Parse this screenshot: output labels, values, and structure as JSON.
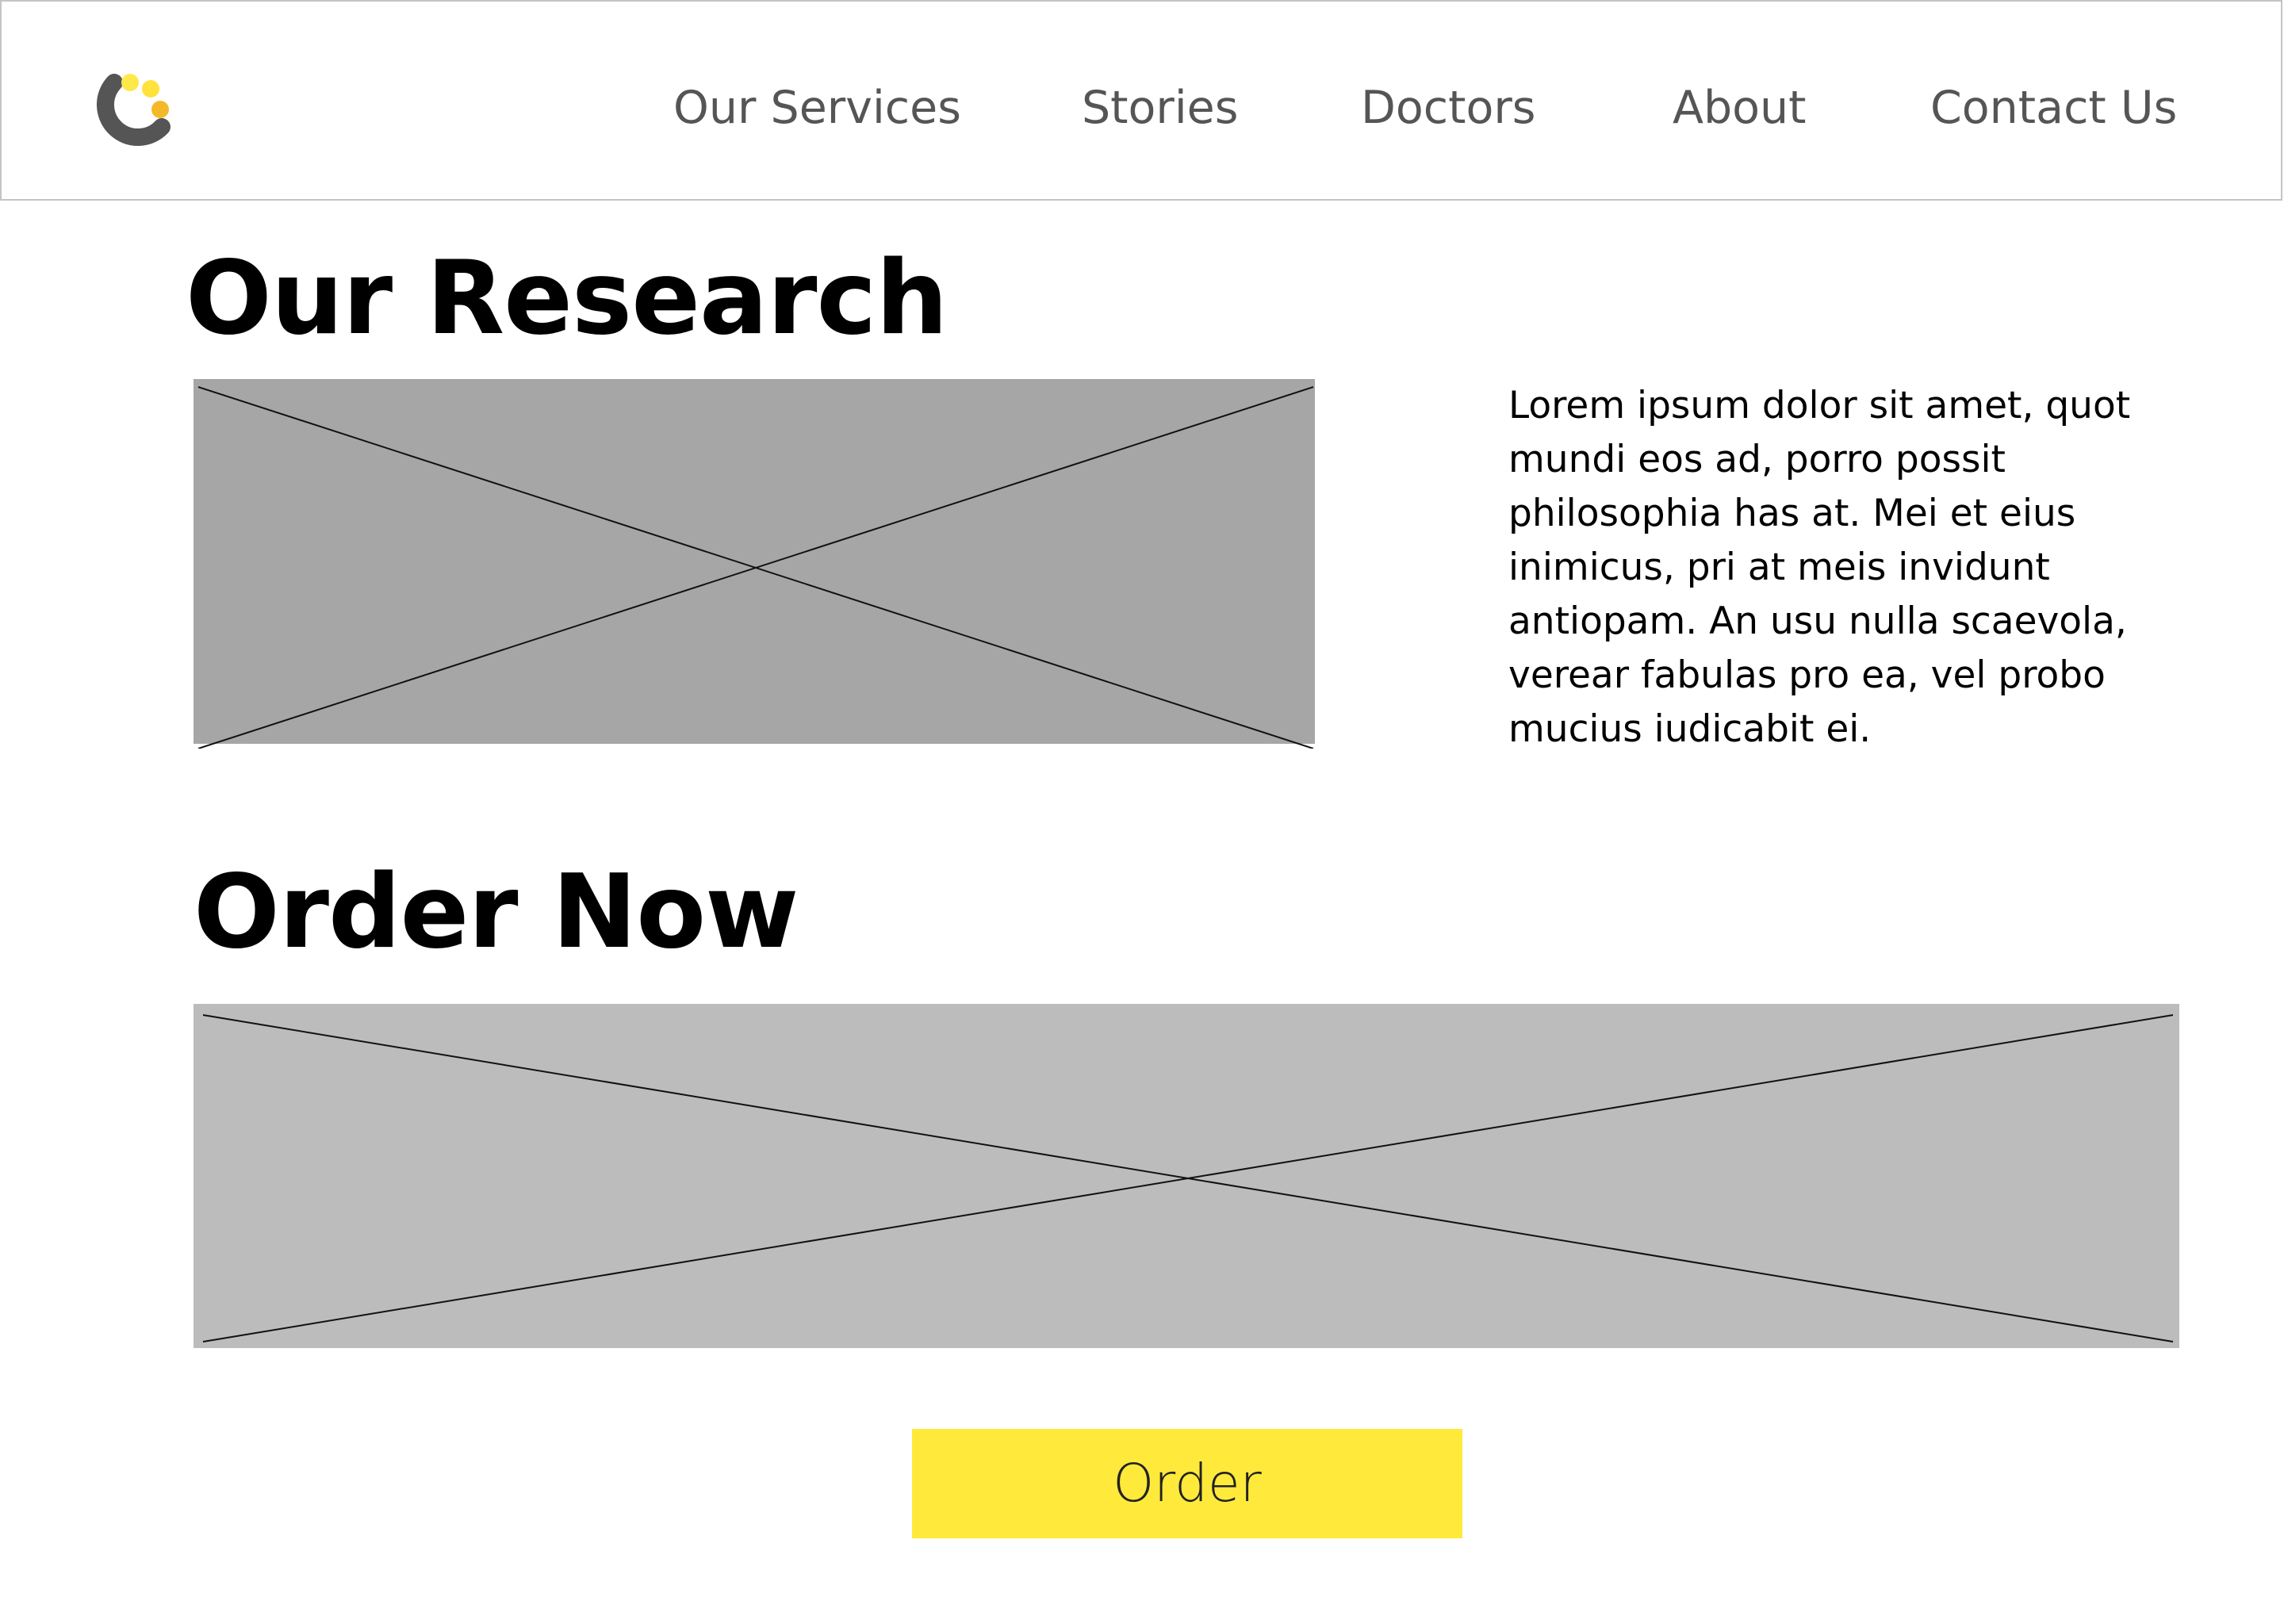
{
  "header": {
    "logo_icon": "logo-icon",
    "logo_colors": {
      "arc": "#555555",
      "dot_top_left": "#ffe84a",
      "dot_top_right": "#ffe23a",
      "dot_right": "#f5b829"
    },
    "nav": {
      "items": [
        {
          "label": "Our Services"
        },
        {
          "label": "Stories"
        },
        {
          "label": "Doctors"
        },
        {
          "label": "About"
        },
        {
          "label": "Contact Us"
        }
      ]
    }
  },
  "research": {
    "title": "Our Research",
    "image_icon": "image-placeholder-icon",
    "paragraph": "Lorem ipsum dolor sit amet, quot mundi eos ad, porro possit philosophia has at. Mei et eius inimicus, pri at meis invidunt antiopam. An usu nulla scaevola, verear fabulas pro ea, vel probo mucius iudicabit ei."
  },
  "order": {
    "title": "Order Now",
    "image_icon": "image-placeholder-icon",
    "button_label": "Order"
  },
  "colors": {
    "background": "#ffffff",
    "header_border": "#c4c4c4",
    "nav_text": "#555555",
    "placeholder_dark": "#a7a6a7",
    "placeholder_light": "#bcbcbc",
    "button": "#ffea3b"
  }
}
